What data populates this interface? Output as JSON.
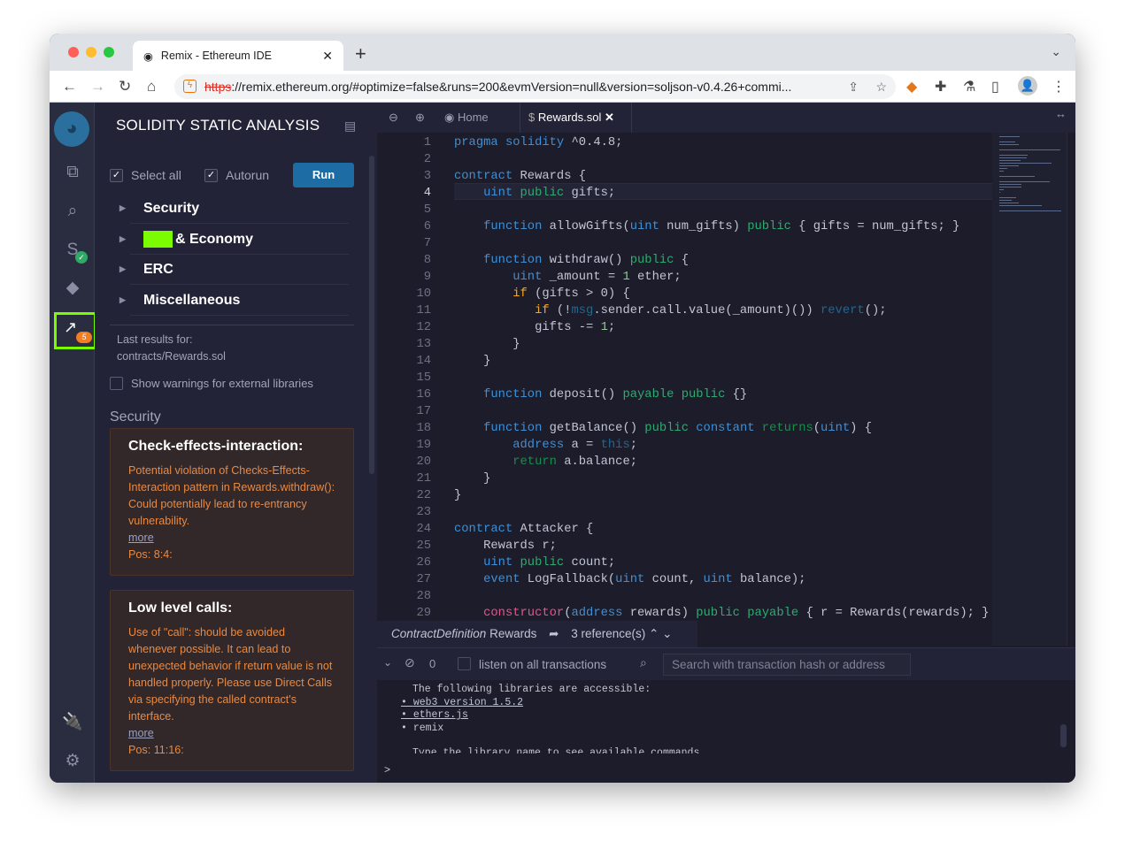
{
  "browser": {
    "tab_title": "Remix - Ethereum IDE",
    "url_scheme": "https",
    "url_rest": "://remix.ethereum.org/#optimize=false&runs=200&evmVersion=null&version=soljson-v0.4.26+commi..."
  },
  "iconbar": {
    "analysis_badge": "5"
  },
  "panel": {
    "title": "SOLIDITY STATIC ANALYSIS",
    "select_all": "Select all",
    "autorun": "Autorun",
    "run": "Run",
    "categories": [
      "Security",
      "& Economy",
      "ERC",
      "Miscellaneous"
    ],
    "last_results_label": "Last results for:",
    "last_results_file": "contracts/Rewards.sol",
    "show_warnings": "Show warnings for external libraries",
    "section": "Security",
    "warnings": [
      {
        "title": "Check-effects-interaction:",
        "text": "Potential violation of Checks-Effects-Interaction pattern in Rewards.withdraw(): Could potentially lead to re-entrancy vulnerability.",
        "more": "more",
        "pos": "Pos: 8:4:"
      },
      {
        "title": "Low level calls:",
        "text": "Use of \"call\": should be avoided whenever possible. It can lead to unexpected behavior if return value is not handled properly. Please use Direct Calls via specifying the called contract's interface.",
        "more": "more",
        "pos": "Pos: 11:16:"
      }
    ]
  },
  "editor": {
    "tabs": [
      "Home",
      "Rewards.sol"
    ],
    "lines": [
      [
        [
          "pragma solidity",
          "k"
        ],
        [
          " ^0.4.8;",
          ""
        ]
      ],
      [],
      [
        [
          "contract",
          "k"
        ],
        [
          " Rewards {",
          ""
        ]
      ],
      [
        [
          "    ",
          ""
        ],
        [
          "uint",
          "k"
        ],
        [
          " ",
          ""
        ],
        [
          "public",
          "g"
        ],
        [
          " gifts;",
          ""
        ]
      ],
      [],
      [
        [
          "    ",
          ""
        ],
        [
          "function",
          "k"
        ],
        [
          " allowGifts(",
          ""
        ],
        [
          "uint",
          "k"
        ],
        [
          " num_gifts) ",
          ""
        ],
        [
          "public",
          "g"
        ],
        [
          " { gifts = num_gifts; }",
          ""
        ]
      ],
      [],
      [
        [
          "    ",
          ""
        ],
        [
          "function",
          "k"
        ],
        [
          " withdraw() ",
          ""
        ],
        [
          "public",
          "g"
        ],
        [
          " {",
          ""
        ]
      ],
      [
        [
          "        ",
          ""
        ],
        [
          "uint",
          "k"
        ],
        [
          " _amount = ",
          ""
        ],
        [
          "1",
          "n"
        ],
        [
          " ether;",
          ""
        ]
      ],
      [
        [
          "        ",
          ""
        ],
        [
          "if",
          "o"
        ],
        [
          " (gifts > 0) {",
          ""
        ]
      ],
      [
        [
          "           ",
          ""
        ],
        [
          "if",
          "o"
        ],
        [
          " (!",
          ""
        ],
        [
          "msg",
          "d"
        ],
        [
          ".sender.call.value(_amount)()) ",
          ""
        ],
        [
          "revert",
          "d"
        ],
        [
          "();",
          ""
        ]
      ],
      [
        [
          "           gifts -= ",
          ""
        ],
        [
          "1",
          "n"
        ],
        [
          ";",
          ""
        ]
      ],
      [
        [
          "        }",
          ""
        ]
      ],
      [
        [
          "    }",
          ""
        ]
      ],
      [],
      [
        [
          "    ",
          ""
        ],
        [
          "function",
          "k"
        ],
        [
          " deposit() ",
          ""
        ],
        [
          "payable public",
          "g"
        ],
        [
          " {}",
          ""
        ]
      ],
      [],
      [
        [
          "    ",
          ""
        ],
        [
          "function",
          "k"
        ],
        [
          " getBalance() ",
          ""
        ],
        [
          "public",
          "g"
        ],
        [
          " ",
          ""
        ],
        [
          "constant",
          "k"
        ],
        [
          " ",
          ""
        ],
        [
          "returns",
          "dg"
        ],
        [
          "(",
          ""
        ],
        [
          "uint",
          "k"
        ],
        [
          ") {",
          ""
        ]
      ],
      [
        [
          "        ",
          ""
        ],
        [
          "address",
          "k"
        ],
        [
          " a = ",
          ""
        ],
        [
          "this",
          "d"
        ],
        [
          ";",
          ""
        ]
      ],
      [
        [
          "        ",
          ""
        ],
        [
          "return",
          "dg"
        ],
        [
          " a.balance;",
          ""
        ]
      ],
      [
        [
          "    }",
          ""
        ]
      ],
      [
        [
          "}",
          ""
        ]
      ],
      [],
      [
        [
          "contract",
          "k"
        ],
        [
          " Attacker {",
          ""
        ]
      ],
      [
        [
          "    Rewards r;",
          ""
        ]
      ],
      [
        [
          "    ",
          ""
        ],
        [
          "uint",
          "k"
        ],
        [
          " ",
          ""
        ],
        [
          "public",
          "g"
        ],
        [
          " count;",
          ""
        ]
      ],
      [
        [
          "    ",
          ""
        ],
        [
          "event",
          "k"
        ],
        [
          " LogFallback(",
          ""
        ],
        [
          "uint",
          "k"
        ],
        [
          " count, ",
          ""
        ],
        [
          "uint",
          "k"
        ],
        [
          " balance);",
          ""
        ]
      ],
      [],
      [
        [
          "    ",
          ""
        ],
        [
          "constructor",
          "p"
        ],
        [
          "(",
          ""
        ],
        [
          "address",
          "k"
        ],
        [
          " rewards) ",
          ""
        ],
        [
          "public payable",
          "g"
        ],
        [
          " { r = Rewards(rewards); }",
          ""
        ]
      ]
    ],
    "peek": {
      "kind": "ContractDefinition",
      "name": "Rewards",
      "refs": "3 reference(s)"
    }
  },
  "terminal": {
    "count": "0",
    "listen": "listen on all transactions",
    "search_placeholder": "Search with transaction hash or address",
    "intro": "The following libraries are accessible:",
    "libs": [
      "web3 version 1.5.2",
      "ethers.js",
      "remix"
    ],
    "hint": "Type the library name to see available commands.",
    "prompt": ">"
  }
}
